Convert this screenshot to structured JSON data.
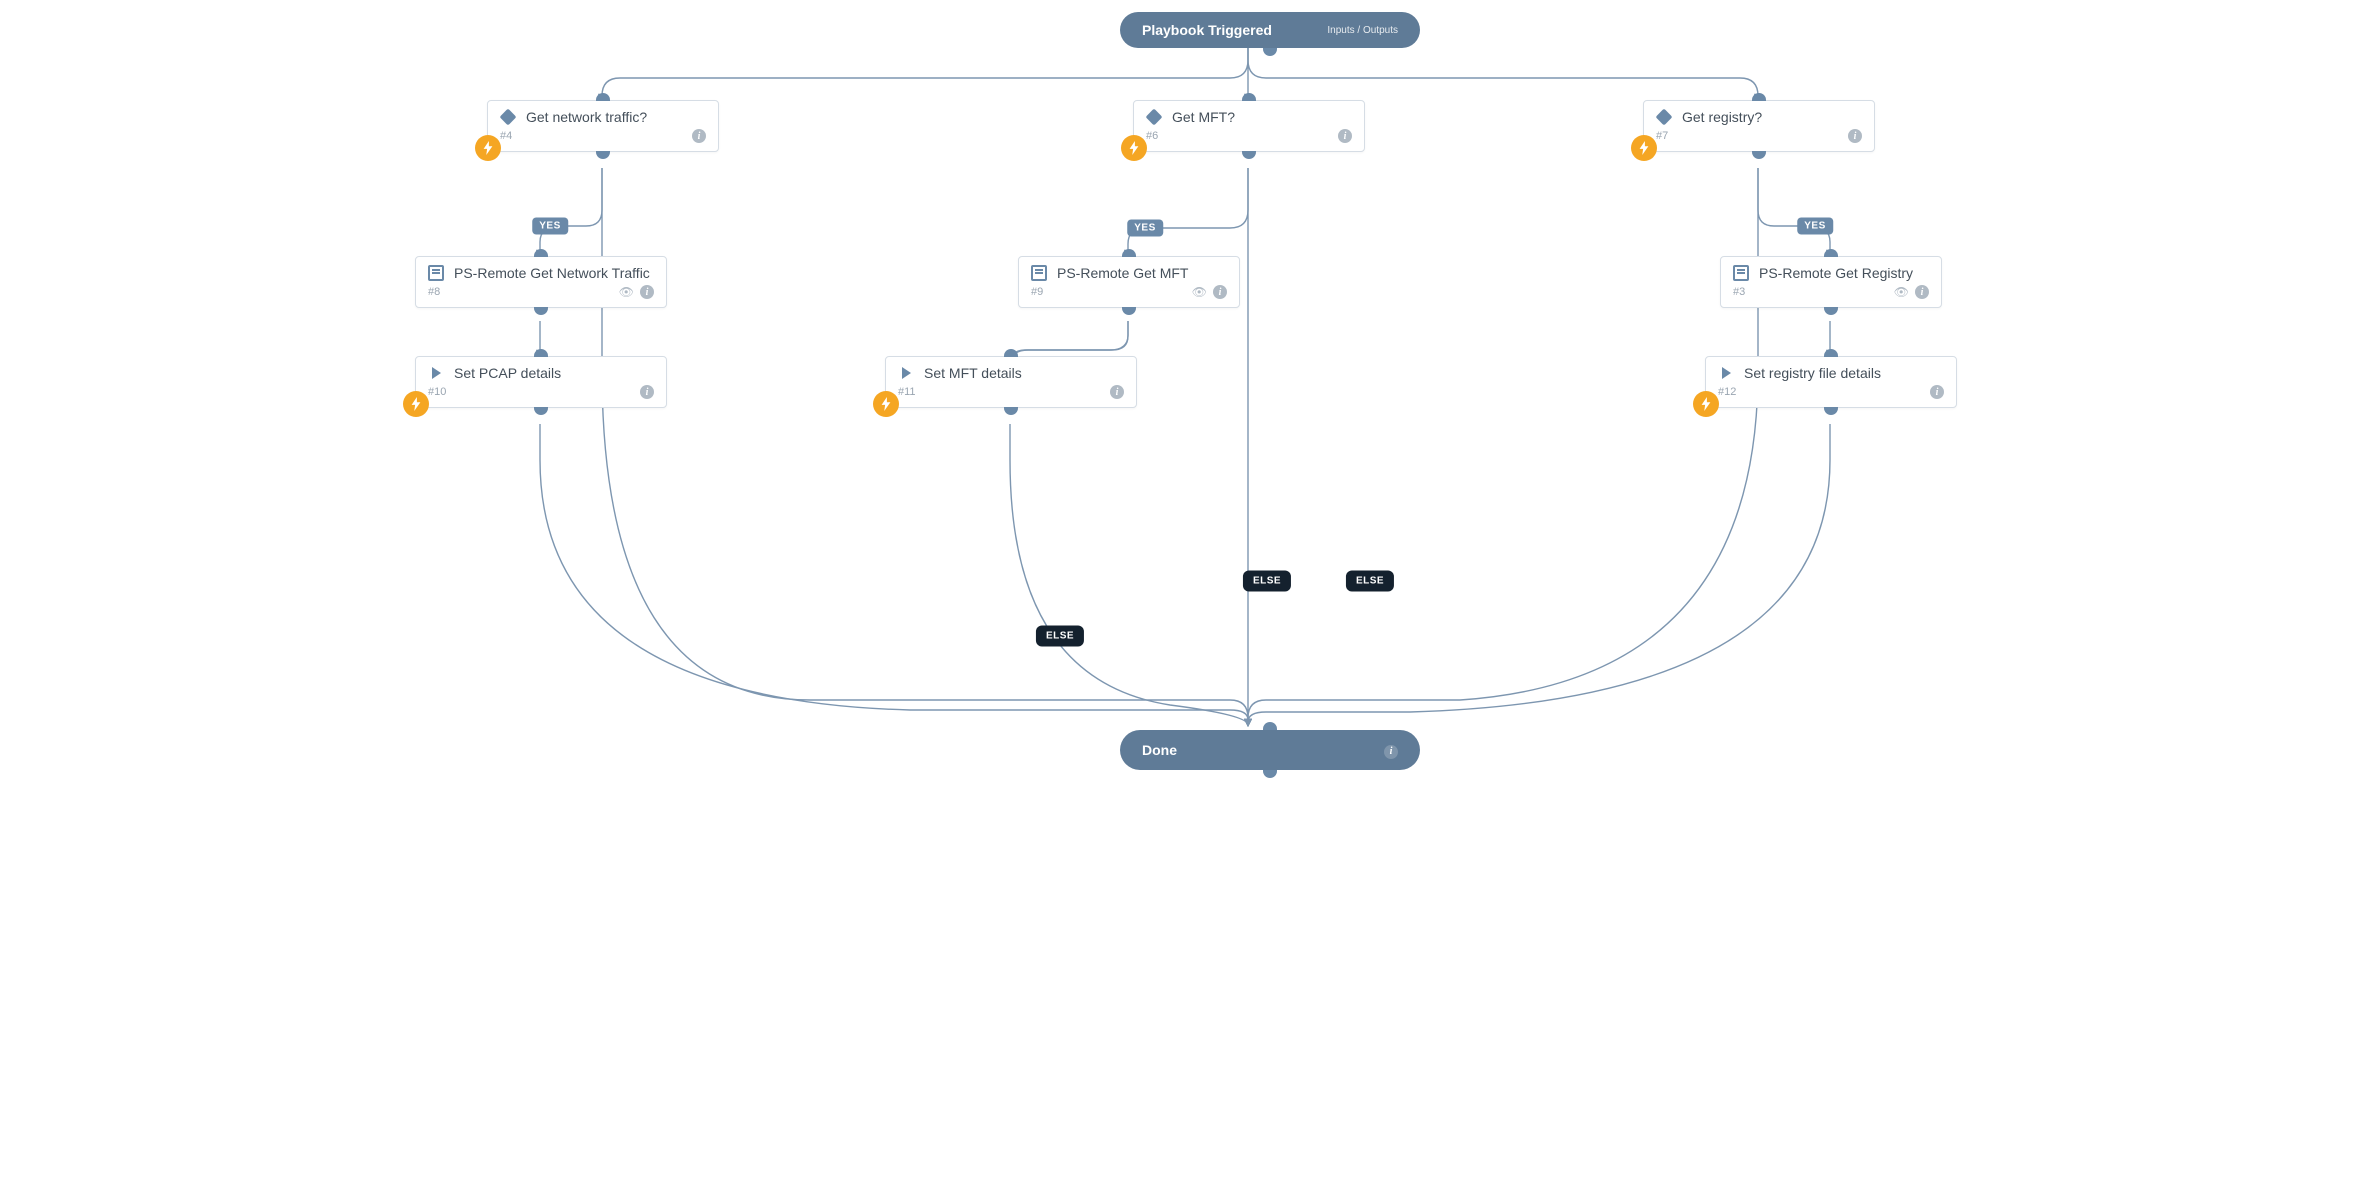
{
  "colors": {
    "wire": "#7d96b0",
    "pill": "#5f7b97",
    "badge": "#f5a623"
  },
  "start": {
    "label": "Playbook Triggered",
    "io_label": "Inputs / Outputs"
  },
  "end": {
    "label": "Done"
  },
  "labels": {
    "yes": "YES",
    "else": "ELSE"
  },
  "nodes": {
    "n4": {
      "title": "Get network traffic?",
      "id": "#4",
      "type": "condition"
    },
    "n6": {
      "title": "Get MFT?",
      "id": "#6",
      "type": "condition"
    },
    "n7": {
      "title": "Get registry?",
      "id": "#7",
      "type": "condition"
    },
    "n8": {
      "title": "PS-Remote Get Network Traffic",
      "id": "#8",
      "type": "playbook"
    },
    "n9": {
      "title": "PS-Remote Get MFT",
      "id": "#9",
      "type": "playbook"
    },
    "n3": {
      "title": "PS-Remote Get Registry",
      "id": "#3",
      "type": "playbook"
    },
    "n10": {
      "title": "Set PCAP details",
      "id": "#10",
      "type": "task"
    },
    "n11": {
      "title": "Set MFT details",
      "id": "#11",
      "type": "task"
    },
    "n12": {
      "title": "Set registry file details",
      "id": "#12",
      "type": "task"
    }
  }
}
